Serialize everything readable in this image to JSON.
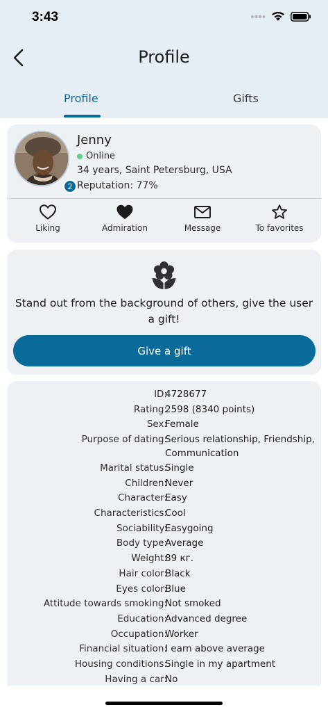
{
  "status_bar": {
    "time": "3:43"
  },
  "nav": {
    "title": "Profile"
  },
  "tabs": [
    {
      "label": "Profile"
    },
    {
      "label": "Gifts"
    }
  ],
  "profile": {
    "name": "Jenny",
    "status": "Online",
    "age_location": "34 years, Saint Petersburg, USA",
    "reputation": "Reputation: 77%",
    "badge_count": "2"
  },
  "actions": [
    {
      "label": "Liking",
      "icon": "heart-outline-icon"
    },
    {
      "label": "Admiration",
      "icon": "heart-filled-icon"
    },
    {
      "label": "Message",
      "icon": "envelope-icon"
    },
    {
      "label": "To favorites",
      "icon": "star-outline-icon"
    }
  ],
  "gift": {
    "text": "Stand out from the background of others, give the user a gift!",
    "button_label": "Give a gift",
    "icon": "flower-icon"
  },
  "details": [
    {
      "label": "ID:",
      "value": "4728677"
    },
    {
      "label": "Rating:",
      "value": "2598 (8340 points)"
    },
    {
      "label": "Sex:",
      "value": "Female"
    },
    {
      "label": "Purpose of dating:",
      "value": "Serious relationship, Friendship, Communication"
    },
    {
      "label": "Marital status:",
      "value": "Single"
    },
    {
      "label": "Children:",
      "value": "Never"
    },
    {
      "label": "Character:",
      "value": "Easy"
    },
    {
      "label": "Characteristics:",
      "value": "Cool"
    },
    {
      "label": "Sociability:",
      "value": "Easygoing"
    },
    {
      "label": "Body type:",
      "value": "Average"
    },
    {
      "label": "Weight:",
      "value": "89 кг."
    },
    {
      "label": "Hair color:",
      "value": "Black"
    },
    {
      "label": "Eyes color:",
      "value": "Blue"
    },
    {
      "label": "Attitude towards smoking:",
      "value": "Not smoked"
    },
    {
      "label": "Education:",
      "value": "Advanced degree"
    },
    {
      "label": "Occupation:",
      "value": "Worker"
    },
    {
      "label": "Financial situation:",
      "value": "I earn above average"
    },
    {
      "label": "Housing conditions:",
      "value": "Single in my apartment"
    },
    {
      "label": "Having a car:",
      "value": "No"
    }
  ],
  "colors": {
    "accent": "#0a6b9b",
    "header_bg": "#e6edf3",
    "card_bg": "#eef1f4",
    "online": "#5fd48a"
  }
}
